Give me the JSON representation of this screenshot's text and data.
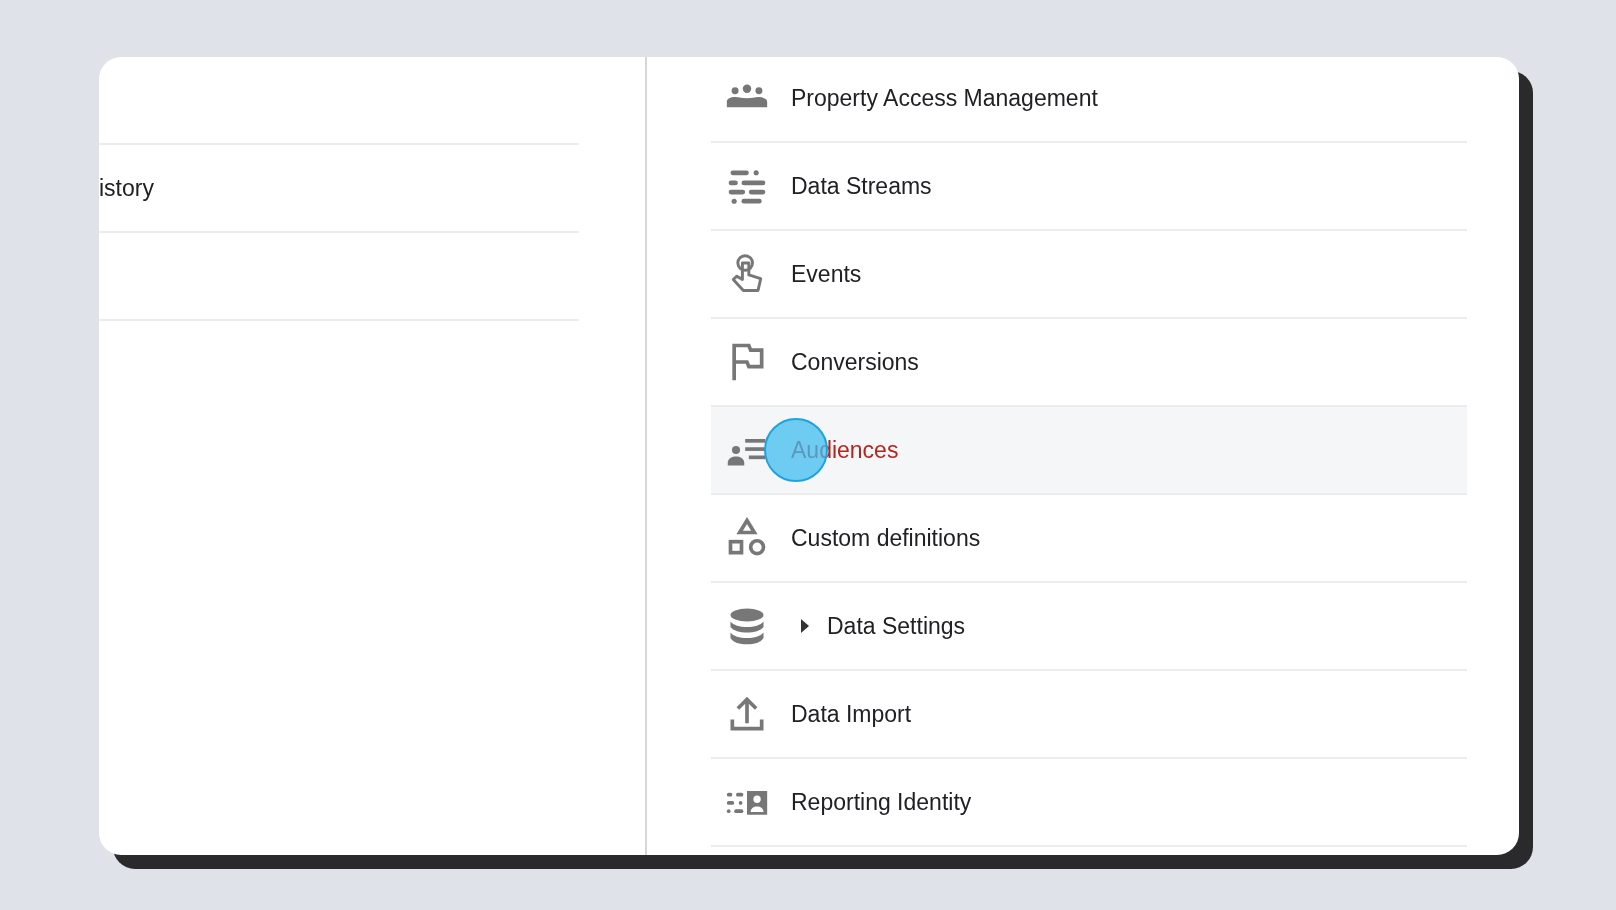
{
  "left_panel": {
    "rows": [
      {
        "kind": "blank"
      },
      {
        "kind": "text",
        "label": "istory"
      },
      {
        "kind": "blank"
      }
    ]
  },
  "right_panel": {
    "items": [
      {
        "label": "Property Access Management",
        "kind": "link",
        "selected": false
      },
      {
        "label": "Data Streams",
        "kind": "link",
        "selected": false
      },
      {
        "label": "Events",
        "kind": "link",
        "selected": false
      },
      {
        "label": "Conversions",
        "kind": "link",
        "selected": false
      },
      {
        "label": "Audiences",
        "kind": "link",
        "selected": true
      },
      {
        "label": "Custom definitions",
        "kind": "link",
        "selected": false
      },
      {
        "label": "Data Settings",
        "kind": "expandable",
        "selected": false
      },
      {
        "label": "Data Import",
        "kind": "link",
        "selected": false
      },
      {
        "label": "Reporting Identity",
        "kind": "link",
        "selected": false
      }
    ]
  }
}
